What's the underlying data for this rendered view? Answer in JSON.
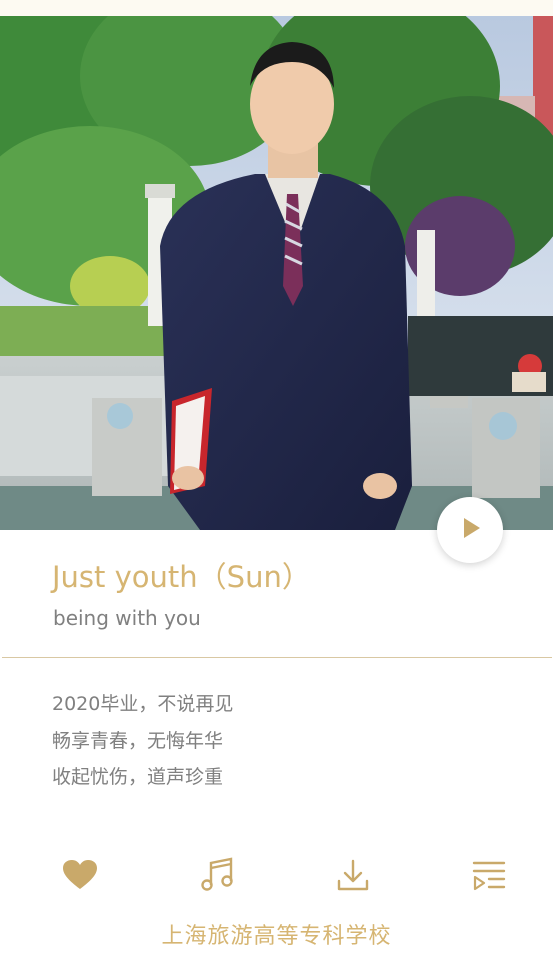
{
  "song": {
    "title": "Just youth（Sun）",
    "subtitle": "being with you"
  },
  "lyrics": [
    "2020毕业，不说再见",
    "畅享青春，无悔年华",
    "收起忧伤，道声珍重"
  ],
  "toolbar": {
    "icons": [
      "heart-icon",
      "music-note-icon",
      "download-icon",
      "playlist-icon"
    ]
  },
  "footer": {
    "school": "上海旅游高等专科学校"
  },
  "colors": {
    "accent": "#d6b572",
    "text": "#808080",
    "divider": "#d9c8a3"
  }
}
